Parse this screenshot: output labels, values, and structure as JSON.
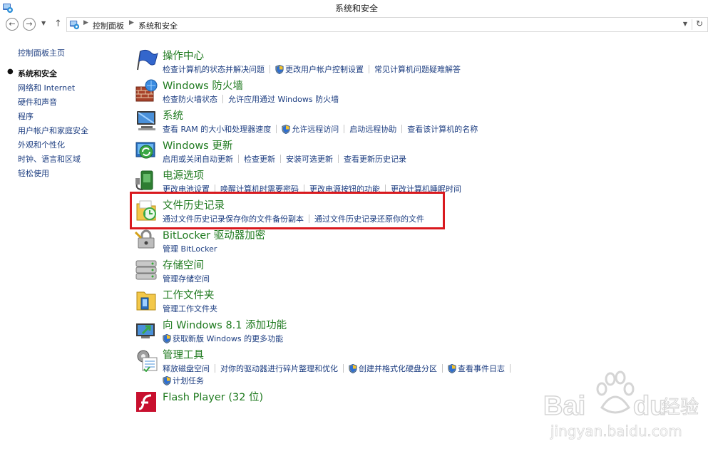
{
  "window": {
    "title": "系统和安全"
  },
  "address": {
    "crumbs": [
      "控制面板",
      "系统和安全"
    ]
  },
  "sidebar": {
    "home": "控制面板主页",
    "items": [
      "系统和安全",
      "网络和 Internet",
      "硬件和声音",
      "程序",
      "用户帐户和家庭安全",
      "外观和个性化",
      "时钟、语言和区域",
      "轻松使用"
    ]
  },
  "categories": [
    {
      "title": "操作中心",
      "icon": "action-center-flag-icon",
      "links": [
        {
          "text": "检查计算机的状态并解决问题",
          "shield": false
        },
        {
          "text": "更改用户帐户控制设置",
          "shield": true
        },
        {
          "text": "常见计算机问题疑难解答",
          "shield": false
        }
      ]
    },
    {
      "title": "Windows 防火墙",
      "icon": "firewall-icon",
      "links": [
        {
          "text": "检查防火墙状态",
          "shield": false
        },
        {
          "text": "允许应用通过 Windows 防火墙",
          "shield": false
        }
      ]
    },
    {
      "title": "系统",
      "icon": "system-computer-icon",
      "links": [
        {
          "text": "查看 RAM 的大小和处理器速度",
          "shield": false
        },
        {
          "text": "允许远程访问",
          "shield": true
        },
        {
          "text": "启动远程协助",
          "shield": false
        },
        {
          "text": "查看该计算机的名称",
          "shield": false
        }
      ]
    },
    {
      "title": "Windows 更新",
      "icon": "windows-update-icon",
      "links": [
        {
          "text": "启用或关闭自动更新",
          "shield": false
        },
        {
          "text": "检查更新",
          "shield": false
        },
        {
          "text": "安装可选更新",
          "shield": false
        },
        {
          "text": "查看更新历史记录",
          "shield": false
        }
      ]
    },
    {
      "title": "电源选项",
      "icon": "power-options-icon",
      "links": [
        {
          "text": "更改电池设置",
          "shield": false
        },
        {
          "text": "唤醒计算机时需要密码",
          "shield": false
        },
        {
          "text": "更改电源按钮的功能",
          "shield": false
        },
        {
          "text": "更改计算机睡眠时间",
          "shield": false
        }
      ]
    },
    {
      "title": "文件历史记录",
      "icon": "file-history-icon",
      "links": [
        {
          "text": "通过文件历史记录保存你的文件备份副本",
          "shield": false
        },
        {
          "text": "通过文件历史记录还原你的文件",
          "shield": false
        }
      ]
    },
    {
      "title": "BitLocker 驱动器加密",
      "icon": "bitlocker-icon",
      "links": [
        {
          "text": "管理 BitLocker",
          "shield": false
        }
      ]
    },
    {
      "title": "存储空间",
      "icon": "storage-spaces-icon",
      "links": [
        {
          "text": "管理存储空间",
          "shield": false
        }
      ]
    },
    {
      "title": "工作文件夹",
      "icon": "work-folders-icon",
      "links": [
        {
          "text": "管理工作文件夹",
          "shield": false
        }
      ]
    },
    {
      "title": "向 Windows 8.1 添加功能",
      "icon": "add-features-icon",
      "links": [
        {
          "text": "获取新版 Windows 的更多功能",
          "shield": true
        }
      ]
    },
    {
      "title": "管理工具",
      "icon": "admin-tools-icon",
      "links": [
        {
          "text": "释放磁盘空间",
          "shield": false
        },
        {
          "text": "对你的驱动器进行碎片整理和优化",
          "shield": false
        },
        {
          "text": "创建并格式化硬盘分区",
          "shield": true
        },
        {
          "text": "查看事件日志",
          "shield": true
        }
      ],
      "links2": [
        {
          "text": "计划任务",
          "shield": true
        }
      ]
    },
    {
      "title": "Flash Player (32 位)",
      "icon": "flash-player-icon",
      "links": []
    }
  ],
  "watermark": {
    "logo_latin": "Bai",
    "logo_latin2": "du",
    "logo_cn": "经验",
    "url": "jingyan.baidu.com"
  },
  "colors": {
    "link": "#1c3d80",
    "title": "#1f7a1f",
    "highlight": "#d9191e"
  }
}
